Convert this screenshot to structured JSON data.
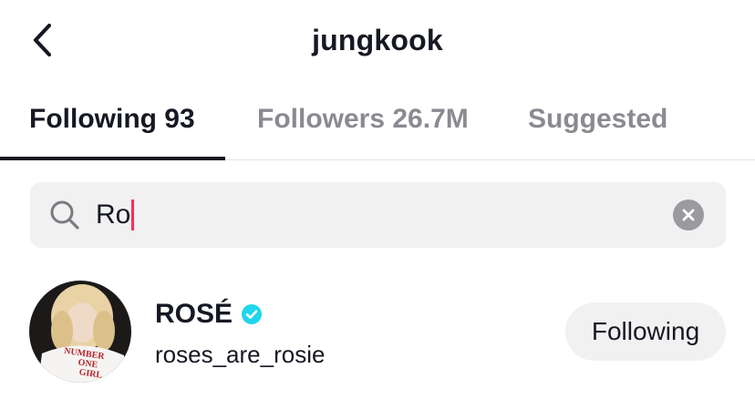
{
  "header": {
    "title": "jungkook",
    "back_icon": "chevron-left-icon"
  },
  "tabs": [
    {
      "label": "Following 93",
      "active": true
    },
    {
      "label": "Followers 26.7M",
      "active": false
    },
    {
      "label": "Suggested",
      "active": false
    }
  ],
  "search": {
    "value": "Ro",
    "icon": "search-icon",
    "clear_icon": "clear-icon",
    "caret_color": "#fe2c55"
  },
  "results": [
    {
      "display_name": "ROSÉ",
      "verified": true,
      "handle": "roses_are_rosie",
      "button_label": "Following",
      "avatar_shirt_text": [
        "NUMBER",
        "ONE",
        "GIRL"
      ]
    }
  ],
  "colors": {
    "text_primary": "#161823",
    "text_secondary": "#8a8b91",
    "verified_badge": "#20d5ec",
    "button_bg": "#f1f1f2"
  }
}
